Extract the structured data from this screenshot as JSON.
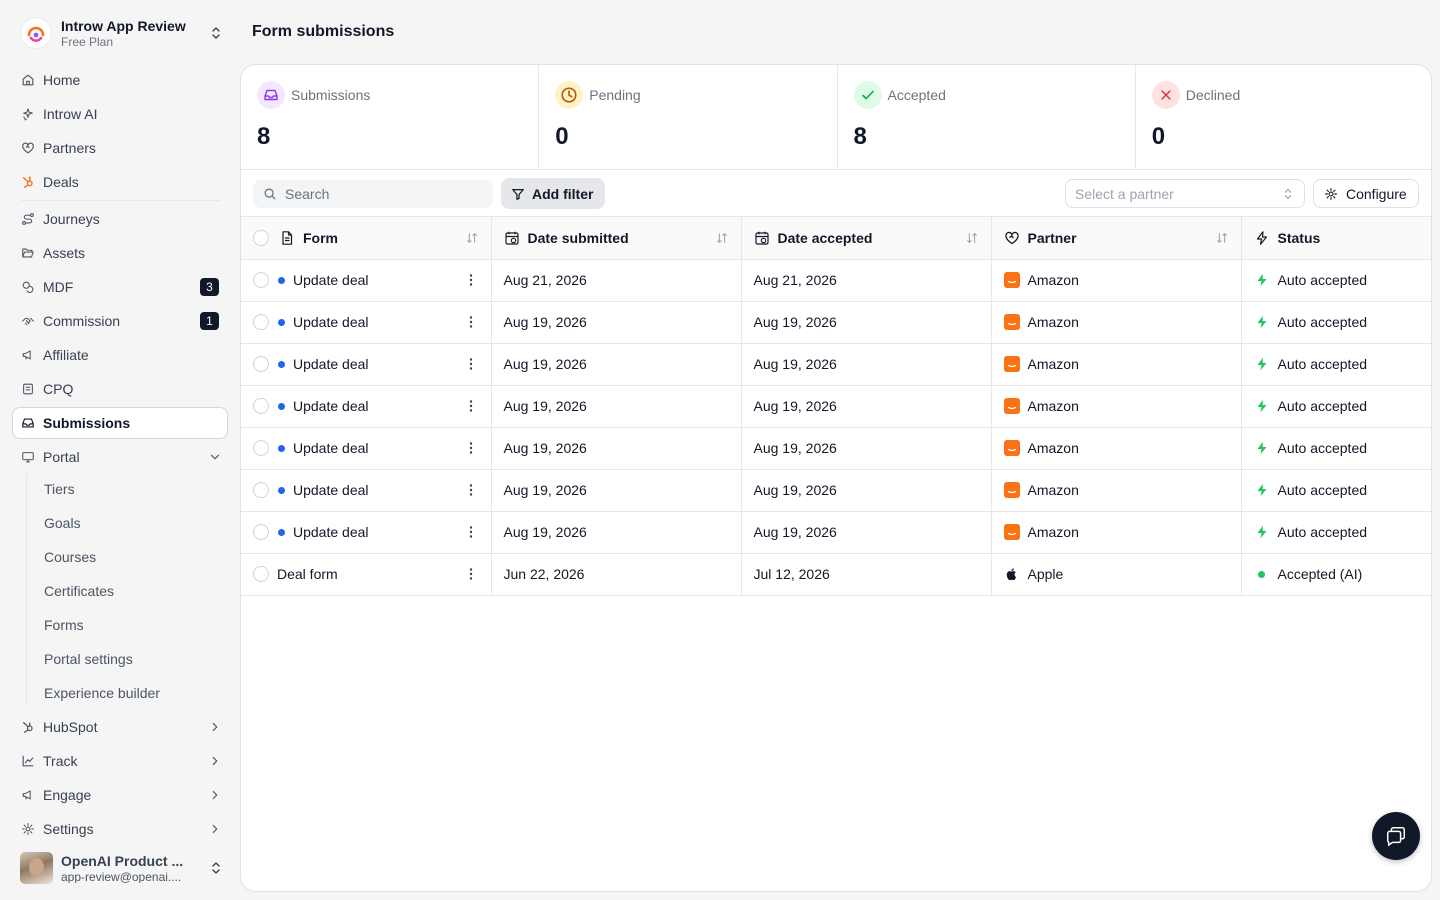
{
  "workspace": {
    "name": "Introw App Review",
    "plan": "Free Plan"
  },
  "nav": {
    "home": "Home",
    "introw_ai": "Introw AI",
    "partners": "Partners",
    "deals": "Deals",
    "journeys": "Journeys",
    "assets": "Assets",
    "mdf": "MDF",
    "mdf_badge": "3",
    "commission": "Commission",
    "commission_badge": "1",
    "affiliate": "Affiliate",
    "cpq": "CPQ",
    "submissions": "Submissions",
    "portal": "Portal",
    "portal_sub": [
      "Tiers",
      "Goals",
      "Courses",
      "Certificates",
      "Forms",
      "Portal settings",
      "Experience builder"
    ],
    "hubspot": "HubSpot",
    "track": "Track",
    "engage": "Engage",
    "settings": "Settings"
  },
  "user": {
    "name": "OpenAI Product ...",
    "email": "app-review@openai...."
  },
  "page": {
    "title": "Form submissions"
  },
  "stats": [
    {
      "label": "Submissions",
      "value": "8"
    },
    {
      "label": "Pending",
      "value": "0"
    },
    {
      "label": "Accepted",
      "value": "8"
    },
    {
      "label": "Declined",
      "value": "0"
    }
  ],
  "toolbar": {
    "search_placeholder": "Search",
    "add_filter": "Add filter",
    "partner_placeholder": "Select a partner",
    "configure": "Configure"
  },
  "table": {
    "columns": [
      "Form",
      "Date submitted",
      "Date accepted",
      "Partner",
      "Status"
    ],
    "rows": [
      {
        "form": "Update deal",
        "submitted": "Aug 21, 2026",
        "accepted": "Aug 21, 2026",
        "partner": "Amazon",
        "status": "Auto accepted"
      },
      {
        "form": "Update deal",
        "submitted": "Aug 19, 2026",
        "accepted": "Aug 19, 2026",
        "partner": "Amazon",
        "status": "Auto accepted"
      },
      {
        "form": "Update deal",
        "submitted": "Aug 19, 2026",
        "accepted": "Aug 19, 2026",
        "partner": "Amazon",
        "status": "Auto accepted"
      },
      {
        "form": "Update deal",
        "submitted": "Aug 19, 2026",
        "accepted": "Aug 19, 2026",
        "partner": "Amazon",
        "status": "Auto accepted"
      },
      {
        "form": "Update deal",
        "submitted": "Aug 19, 2026",
        "accepted": "Aug 19, 2026",
        "partner": "Amazon",
        "status": "Auto accepted"
      },
      {
        "form": "Update deal",
        "submitted": "Aug 19, 2026",
        "accepted": "Aug 19, 2026",
        "partner": "Amazon",
        "status": "Auto accepted"
      },
      {
        "form": "Update deal",
        "submitted": "Aug 19, 2026",
        "accepted": "Aug 19, 2026",
        "partner": "Amazon",
        "status": "Auto accepted"
      },
      {
        "form": "Deal form",
        "submitted": "Jun 22, 2026",
        "accepted": "Jul 12, 2026",
        "partner": "Apple",
        "status": "Accepted (AI)"
      }
    ]
  },
  "colors": {
    "accent": "#111827",
    "amazon": "#f97316",
    "success": "#22c55e",
    "dot_blue": "#2563eb"
  }
}
